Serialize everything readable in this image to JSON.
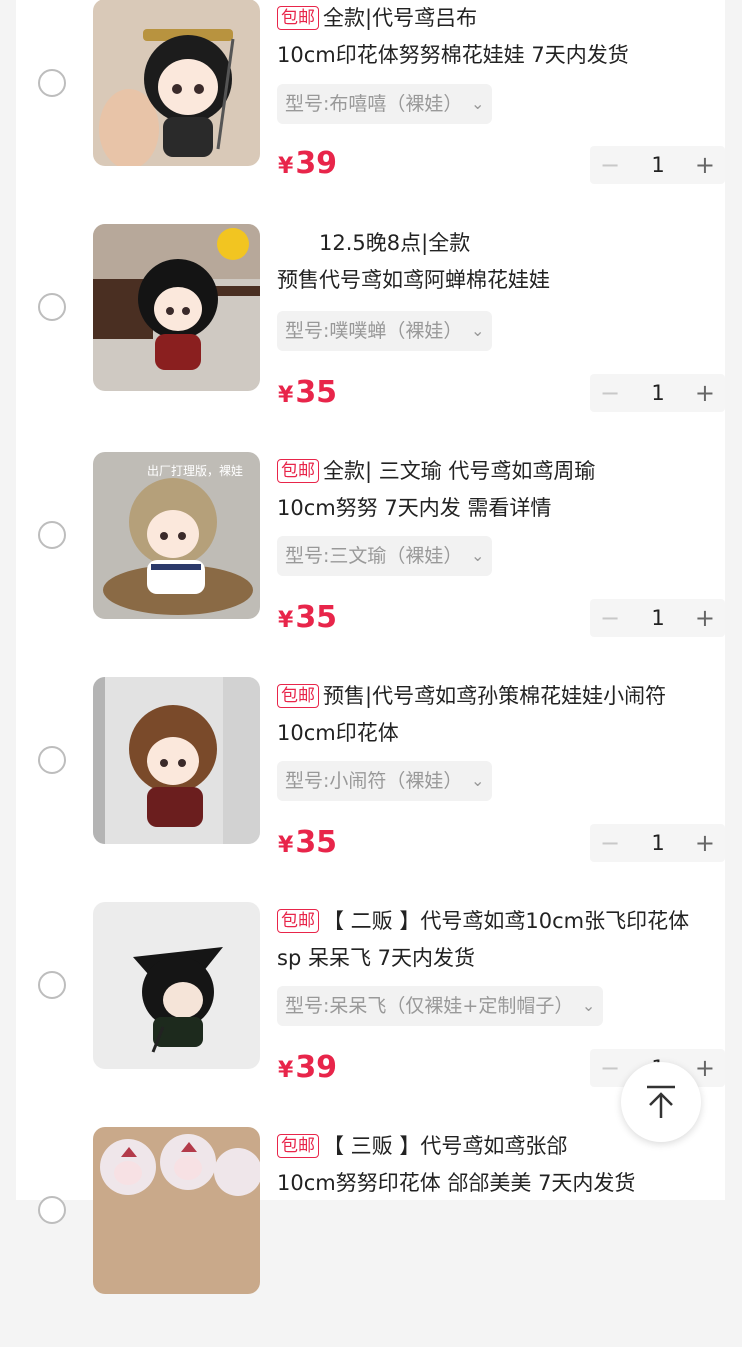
{
  "items": [
    {
      "tag": "包邮",
      "title_line1": "全款|代号鸢吕布",
      "title_line2": "10cm印花体努努棉花娃娃 7天内发货",
      "variant": "型号:布嘻嘻（裸娃）",
      "currency": "¥",
      "price": "39",
      "quantity": "1",
      "thumb_caption": "",
      "colors": {
        "bg": "#d9c9b8",
        "hair": "#1c1c1c",
        "face": "#fbe8dc",
        "outfit": "#2a2a2a"
      }
    },
    {
      "tag": "",
      "title_line1": "　　12.5晚8点|全款",
      "title_line2": "预售代号鸢如鸢阿蝉棉花娃娃",
      "variant": "型号:噗噗蝉（裸娃）",
      "currency": "¥",
      "price": "35",
      "quantity": "1",
      "thumb_caption": "",
      "colors": {
        "bg": "#cfc9c2",
        "hair": "#141414",
        "face": "#fbe8dc",
        "outfit": "#8a1f1f"
      }
    },
    {
      "tag": "包邮",
      "title_line1": "全款| 三文瑜 代号鸢如鸢周瑜",
      "title_line2": "10cm努努 7天内发 需看详情",
      "variant": "型号:三文瑜（裸娃）",
      "currency": "¥",
      "price": "35",
      "quantity": "1",
      "thumb_caption": "出厂打理版，裸娃",
      "colors": {
        "bg": "#bfbcb6",
        "hair": "#b5a07a",
        "face": "#fbe8dc",
        "outfit": "#ffffff"
      }
    },
    {
      "tag": "包邮",
      "title_line1": "预售|代号鸢如鸢孙策棉花娃娃小闹符",
      "title_line2": "10cm印花体",
      "variant": "型号:小闹符（裸娃）",
      "currency": "¥",
      "price": "35",
      "quantity": "1",
      "thumb_caption": "",
      "colors": {
        "bg": "#e2e2e2",
        "hair": "#7a4a2a",
        "face": "#fbe8dc",
        "outfit": "#6b1e1e"
      }
    },
    {
      "tag": "包邮",
      "title_line1": "【 二贩 】代号鸢如鸢10cm张飞印花体",
      "title_line2": "sp 呆呆飞 7天内发货",
      "variant": "型号:呆呆飞（仅裸娃+定制帽子）",
      "currency": "¥",
      "price": "39",
      "quantity": "1",
      "thumb_caption": "",
      "colors": {
        "bg": "#ececec",
        "hair": "#151515",
        "face": "#f5e4d8",
        "outfit": "#1d2a1d"
      }
    },
    {
      "tag": "包邮",
      "title_line1": "【 三贩 】代号鸢如鸢张郃",
      "title_line2": "10cm努努印花体 郃郃美美 7天内发货",
      "variant": "",
      "currency": "¥",
      "price": "",
      "quantity": "",
      "thumb_caption": "",
      "colors": {
        "bg": "#c9a98a",
        "hair": "#efe6ea",
        "face": "#f7e1e4",
        "outfit": "#b33a4a"
      }
    }
  ],
  "back_to_top_icon": "arrow-up-to-line-icon"
}
